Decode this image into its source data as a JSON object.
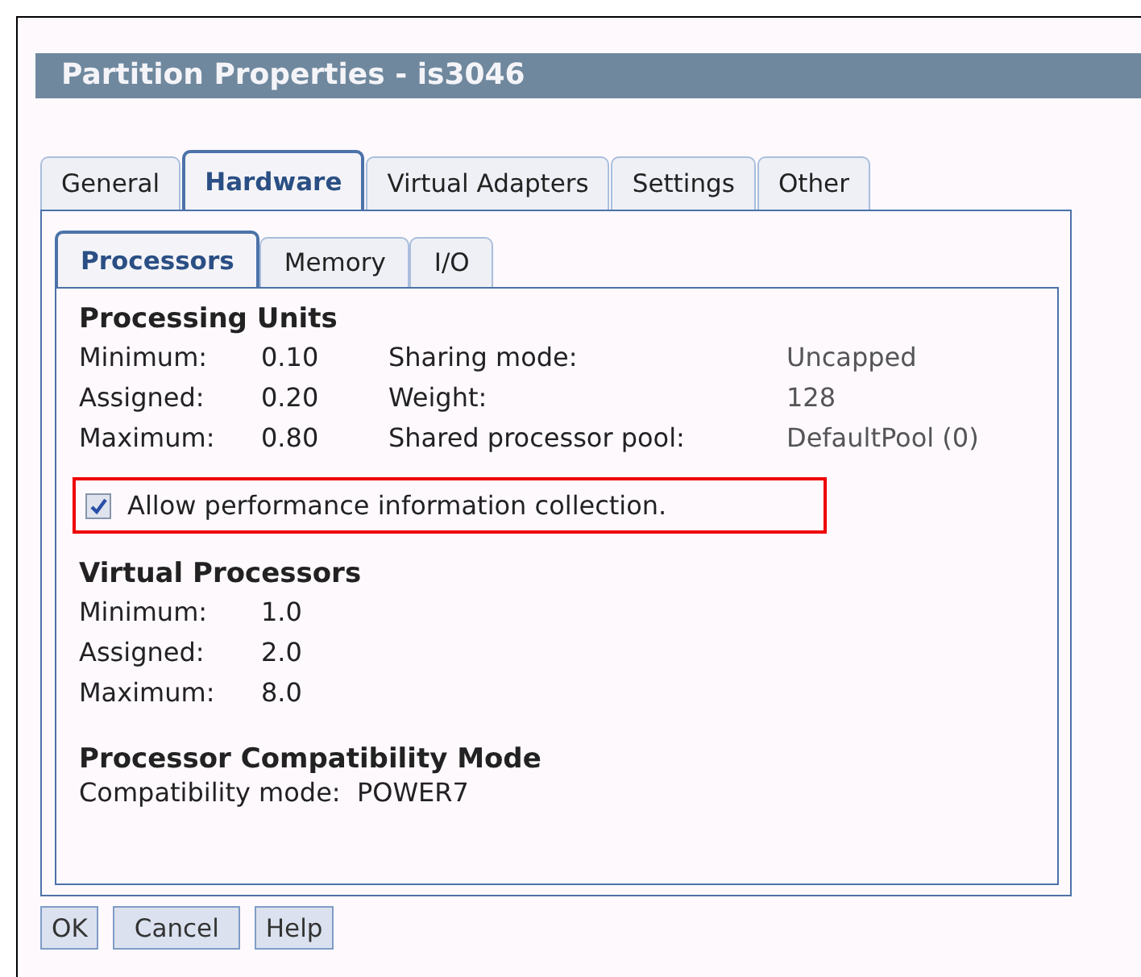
{
  "window": {
    "title": "Partition Properties - is3046"
  },
  "tabs": [
    {
      "label": "General",
      "selected": false
    },
    {
      "label": "Hardware",
      "selected": true
    },
    {
      "label": "Virtual Adapters",
      "selected": false
    },
    {
      "label": "Settings",
      "selected": false
    },
    {
      "label": "Other",
      "selected": false
    }
  ],
  "subtabs": [
    {
      "label": "Processors",
      "selected": true
    },
    {
      "label": "Memory",
      "selected": false
    },
    {
      "label": "I/O",
      "selected": false
    }
  ],
  "processing_units": {
    "heading": "Processing Units",
    "rows": [
      {
        "label": "Minimum:",
        "value": "0.10",
        "label_2": "Sharing mode:",
        "value_2": "Uncapped"
      },
      {
        "label": "Assigned:",
        "value": "0.20",
        "label_2": "Weight:",
        "value_2": "128"
      },
      {
        "label": "Maximum:",
        "value": "0.80",
        "label_2": "Shared processor pool:",
        "value_2": "DefaultPool (0)"
      }
    ]
  },
  "performance_checkbox": {
    "label": "Allow performance information collection.",
    "checked": true,
    "highlighted": true
  },
  "virtual_processors": {
    "heading": "Virtual Processors",
    "rows": [
      {
        "label": "Minimum:",
        "value": "1.0"
      },
      {
        "label": "Assigned:",
        "value": "2.0"
      },
      {
        "label": "Maximum:",
        "value": "8.0"
      }
    ]
  },
  "compatibility": {
    "heading": "Processor Compatibility Mode",
    "label": "Compatibility mode:",
    "value": "POWER7"
  },
  "buttons": [
    "OK",
    "Cancel",
    "Help"
  ]
}
